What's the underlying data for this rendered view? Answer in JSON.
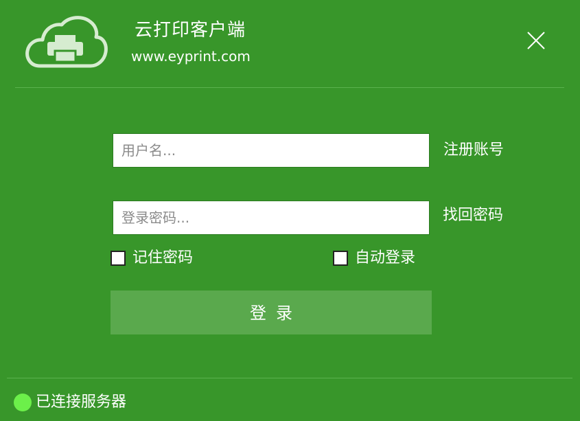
{
  "header": {
    "title": "云打印客户端",
    "url": "www.eyprint.com",
    "logo_icon": "cloud-printer-icon",
    "close_icon": "close-icon"
  },
  "form": {
    "username_placeholder": "用户名...",
    "username_value": "",
    "password_placeholder": "登录密码...",
    "password_value": "",
    "register_label": "注册账号",
    "recover_label": "找回密码",
    "remember_label": "记住密码",
    "remember_checked": false,
    "autologin_label": "自动登录",
    "autologin_checked": false,
    "login_label": "登录"
  },
  "status": {
    "text": "已连接服务器",
    "dot_color": "#6cf04a"
  },
  "colors": {
    "background": "#38962a",
    "login_button": "#5aa94d",
    "divider": "#5ab24e"
  }
}
